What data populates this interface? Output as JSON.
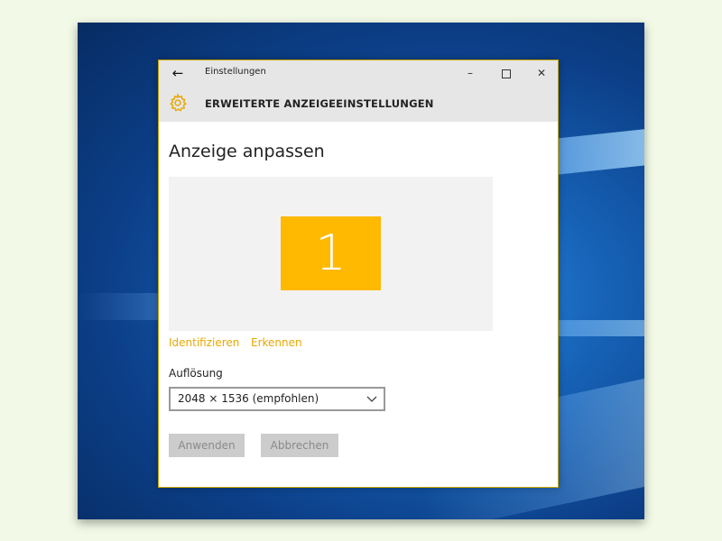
{
  "window": {
    "app_title": "Einstellungen",
    "section_title": "ERWEITERTE ANZEIGEEINSTELLUNGEN",
    "back_icon": "back-arrow-icon",
    "settings_icon": "gear-icon"
  },
  "main": {
    "page_title": "Anzeige anpassen",
    "monitor_number": "1",
    "links": {
      "identify": "Identifizieren",
      "detect": "Erkennen"
    },
    "resolution": {
      "label": "Auflösung",
      "value": "2048 × 1536 (empfohlen)"
    },
    "buttons": {
      "apply": "Anwenden",
      "cancel": "Abbrechen"
    }
  },
  "colors": {
    "accent": "#ffb900",
    "link": "#e8a800",
    "header_bg": "#e6e6e6",
    "disabled_button_bg": "#cccccc",
    "disabled_button_text": "#8a8a8a"
  }
}
